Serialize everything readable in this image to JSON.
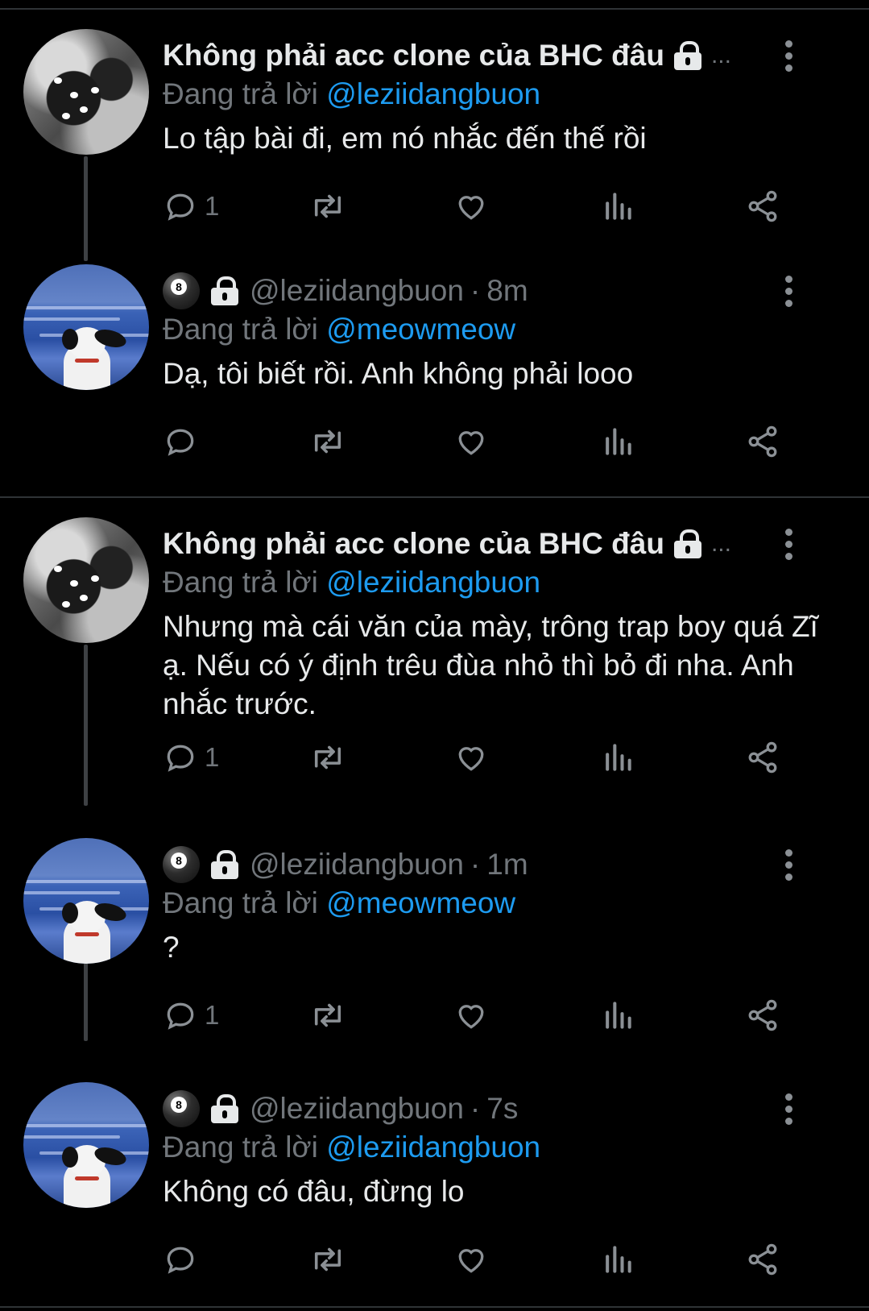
{
  "tweets": [
    {
      "avatar": "cat-avatar",
      "display_name": "Không phải acc clone của BHC đâu",
      "handle": "",
      "time": "",
      "overflow": "...",
      "reply_prefix": "Đang trả lời",
      "reply_to": "@leziidangbuon",
      "text": "Lo tập bài đi, em nó nhắc đến thế rồi",
      "reply_count": "1"
    },
    {
      "avatar": "sea-avatar",
      "display_name": "",
      "handle": "@leziidangbuon",
      "time": "8m",
      "reply_prefix": "Đang trả lời",
      "reply_to": "@meowmeow",
      "text": "Dạ, tôi biết rồi. Anh không phải looo",
      "reply_count": ""
    },
    {
      "avatar": "cat-avatar",
      "display_name": "Không phải acc clone của BHC đâu",
      "handle": "",
      "time": "",
      "overflow": "...",
      "reply_prefix": "Đang trả lời",
      "reply_to": "@leziidangbuon",
      "text": "Nhưng mà cái văn của mày, trông trap boy quá Zĩ ạ. Nếu có ý định trêu đùa nhỏ thì bỏ đi nha. Anh nhắc trước.",
      "reply_count": "1"
    },
    {
      "avatar": "sea-avatar",
      "display_name": "",
      "handle": "@leziidangbuon",
      "time": "1m",
      "reply_prefix": "Đang trả lời",
      "reply_to": "@meowmeow",
      "text": "?",
      "reply_count": "1"
    },
    {
      "avatar": "sea-avatar",
      "display_name": "",
      "handle": "@leziidangbuon",
      "time": "7s",
      "reply_prefix": "Đang trả lời",
      "reply_to": "@leziidangbuon",
      "text": "Không có đâu, đừng lo",
      "reply_count": ""
    }
  ],
  "separator": "·",
  "ball_number": "8",
  "colors": {
    "background": "#000000",
    "text": "#e7e9ea",
    "muted": "#71767b",
    "mention": "#1d9bf0",
    "divider": "#2f3336"
  },
  "icons": [
    "reply-icon",
    "retweet-icon",
    "like-icon",
    "views-icon",
    "share-icon",
    "more-icon",
    "lock-icon",
    "8-ball-icon"
  ]
}
